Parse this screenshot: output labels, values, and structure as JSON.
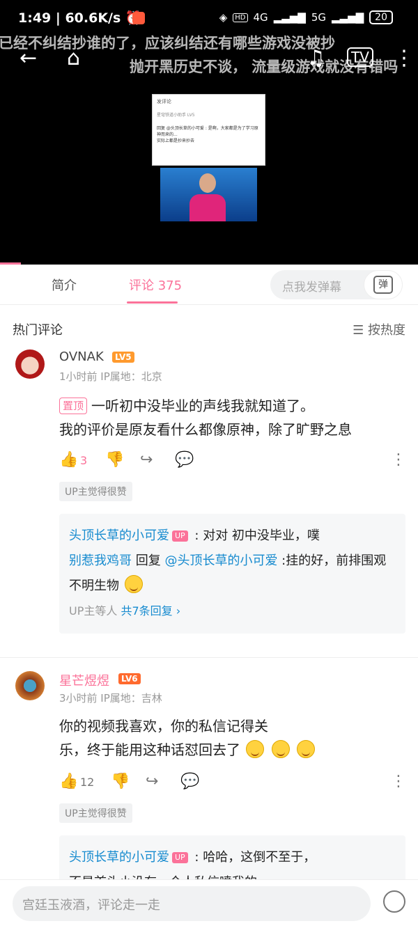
{
  "status": {
    "time": "1:49",
    "speed": "60.6K/s",
    "battery": "20",
    "net1": "4G",
    "net2": "5G",
    "hd": "HD"
  },
  "video": {
    "danmaku": [
      "已经不纠结抄谁的了，应该纠结还有哪些游戏没被抄",
      "抛开黑历史不谈，  流量级游戏就没有错吗"
    ],
    "thumb_title": "发评论",
    "thumb_lines": [
      "星穹铁道小助手 LV5",
      "回复 @头顶长草的小可爱 : 是啊，大家都是为了学习原神而来的...",
      "实际上都是抄来抄去"
    ]
  },
  "tabs": {
    "intro": "简介",
    "comments": "评论 375"
  },
  "danmaku_input": {
    "placeholder": "点我发弹幕",
    "button": "弹"
  },
  "hot": {
    "title": "热门评论",
    "sort": "☰ 按热度"
  },
  "comments": [
    {
      "name": "OVNAK",
      "level": "LV5",
      "meta": "1小时前  IP属地：北京",
      "pin": "置顶",
      "line1": "一听初中没毕业的声线我就知道了。",
      "line2": "我的评价是原友看什么都像原神，除了旷野之息",
      "likes": "3",
      "up_badge": "UP主觉得很赞",
      "replies": {
        "r1_name": "头顶长草的小可爱",
        "r1_tag": "UP",
        "r1_text": " : 对对 初中没毕业，噗",
        "r2_name": "别惹我鸡哥",
        "r2_mid": " 回复 ",
        "r2_at": "@头顶长草的小可爱",
        "r2_text": " :挂的好，前排围观不明生物",
        "more_prefix": "UP主等人 ",
        "more_link": "共7条回复 ›"
      }
    },
    {
      "name": "星芒煜煜",
      "level": "LV6",
      "meta": "3小时前  IP属地：吉林",
      "line1": "你的视频我喜欢，你的私信记得关",
      "line2": "乐，终于能用这种话怼回去了",
      "likes": "12",
      "up_badge": "UP主觉得很赞",
      "replies": {
        "r1_name": "头顶长草的小可爱",
        "r1_tag": "UP",
        "r1_text": " :  哈哈，这倒不至于，",
        "r1_cont": "不是首头小没有一个人私信喷我的"
      }
    }
  ],
  "bottom": {
    "placeholder": "宫廷玉液酒，评论走一走"
  },
  "colors": {
    "accent": "#fb7299",
    "link": "#178bcf",
    "level": "#ff9a2e"
  }
}
